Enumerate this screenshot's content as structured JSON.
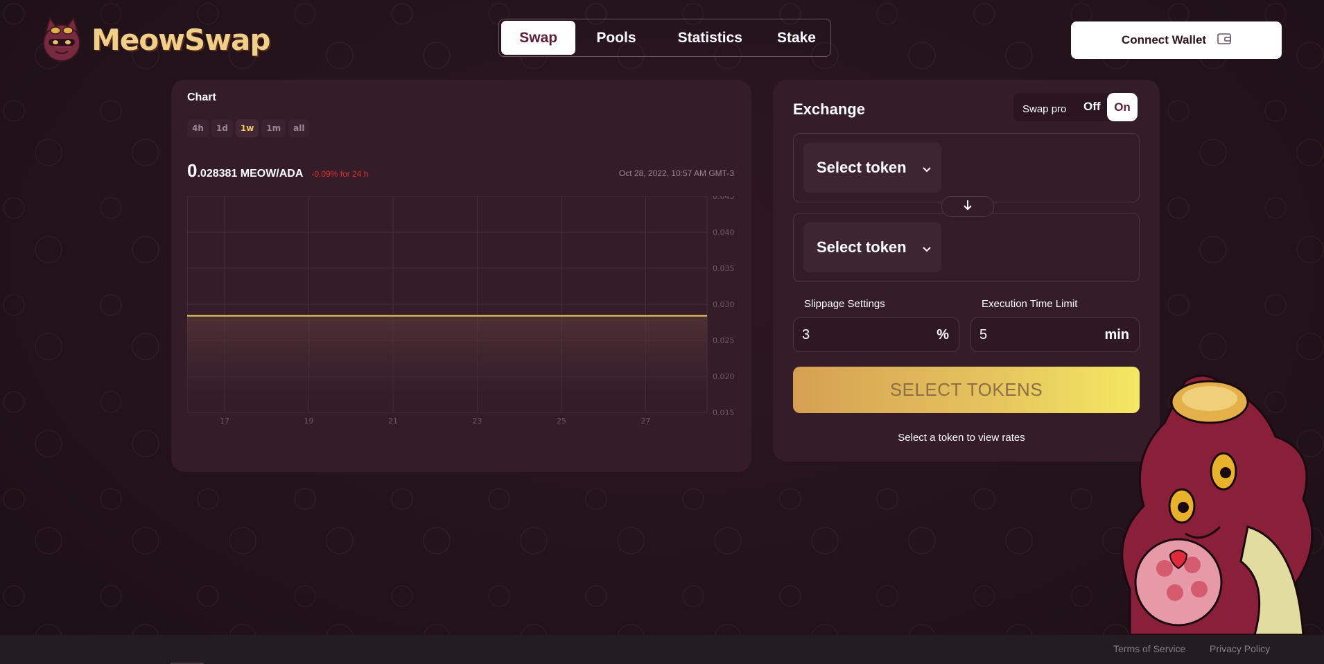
{
  "brand": {
    "name": "MeowSwap"
  },
  "nav": {
    "tabs": [
      {
        "label": "Swap",
        "active": true
      },
      {
        "label": "Pools",
        "active": false
      },
      {
        "label": "Statistics",
        "active": false
      },
      {
        "label": "Stake",
        "active": false
      }
    ]
  },
  "wallet": {
    "connect_label": "Connect Wallet",
    "icon": "wallet-icon"
  },
  "chart_panel": {
    "title": "Chart",
    "ranges": [
      "4h",
      "1d",
      "1w",
      "1m",
      "all"
    ],
    "active_range": "1w",
    "price_lead": "0",
    "price_rest": ".028381 MEOW/ADA",
    "change": "-0.09% for 24 h",
    "timestamp": "Oct 28, 2022, 10:57 AM GMT-3"
  },
  "chart_data": {
    "type": "area",
    "x": [
      "17",
      "19",
      "21",
      "23",
      "25",
      "27"
    ],
    "xticks": [
      "17",
      "19",
      "21",
      "23",
      "25",
      "27"
    ],
    "series": [
      {
        "values": [
          0.0284,
          0.0284,
          0.0284,
          0.0284,
          0.0284,
          0.0284
        ]
      }
    ],
    "yticks": [
      "0.045",
      "0.040",
      "0.035",
      "0.030",
      "0.025",
      "0.020",
      "0.015"
    ],
    "ylim": [
      0.015,
      0.045
    ],
    "grid": true,
    "colors": {
      "line": "#f2cf5b"
    }
  },
  "exchange": {
    "title": "Exchange",
    "swap_pro_label": "Swap pro",
    "toggle_off": "Off",
    "toggle_on": "On",
    "from_token": "Select token",
    "to_token": "Select token",
    "slippage_label": "Slippage Settings",
    "slippage_value": "3",
    "slippage_unit": "%",
    "time_label": "Execution Time Limit",
    "time_value": "5",
    "time_unit": "min",
    "submit_label": "SELECT TOKENS",
    "hint": "Select a token to view rates"
  },
  "footer": {
    "terms": "Terms of Service",
    "privacy": "Privacy Policy"
  },
  "colors": {
    "accent": "#f2cf5b",
    "panel": "#341c28",
    "negative": "#e0332f"
  }
}
